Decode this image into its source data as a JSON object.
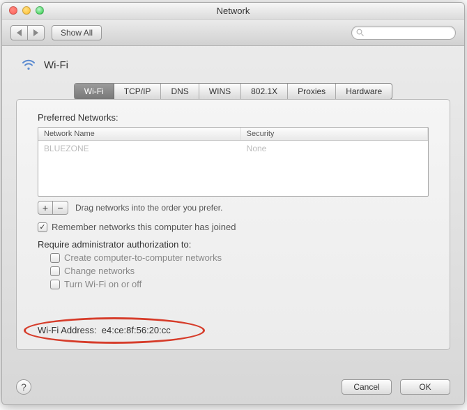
{
  "window": {
    "title": "Network"
  },
  "toolbar": {
    "show_all": "Show All"
  },
  "header": {
    "wifi_label": "Wi-Fi"
  },
  "tabs": {
    "wifi": "Wi-Fi",
    "tcpip": "TCP/IP",
    "dns": "DNS",
    "wins": "WINS",
    "dot1x": "802.1X",
    "proxies": "Proxies",
    "hardware": "Hardware"
  },
  "panel": {
    "preferred_label": "Preferred Networks:",
    "cols": {
      "name": "Network Name",
      "security": "Security"
    },
    "row0": {
      "name": "BLUEZONE",
      "security": "None"
    },
    "drag_hint": "Drag networks into the order you prefer.",
    "remember": "Remember networks this computer has joined",
    "require_label": "Require administrator authorization to:",
    "auth_c2c": "Create computer-to-computer networks",
    "auth_change": "Change networks",
    "auth_toggle": "Turn Wi-Fi on or off",
    "addr_label": "Wi-Fi Address:",
    "addr_value": "e4:ce:8f:56:20:cc"
  },
  "footer": {
    "cancel": "Cancel",
    "ok": "OK"
  }
}
